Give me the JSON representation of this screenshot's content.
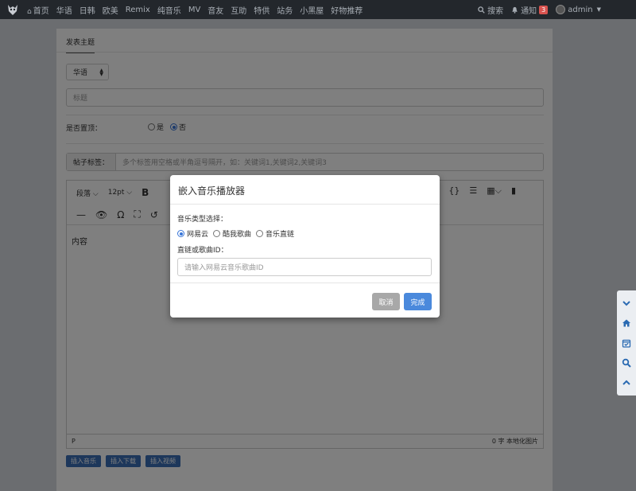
{
  "navbar": {
    "home": "首页",
    "items": [
      "华语",
      "日韩",
      "欧美",
      "Remix",
      "纯音乐",
      "MV",
      "音友",
      "互助",
      "特供",
      "站务",
      "小黑屋",
      "好物推荐"
    ],
    "search": "搜索",
    "notify": "通知",
    "notify_count": "3",
    "user": "admin"
  },
  "form": {
    "page_title": "发表主题",
    "lang_select": "华语",
    "title_placeholder": "标题",
    "pin_label": "是否置顶：",
    "pin_yes": "是",
    "pin_no": "否",
    "tag_label": "帖子标签：",
    "tag_placeholder": "多个标签用空格或半角逗号隔开，如：关键词1,关键词2,关键词3"
  },
  "editor": {
    "block_format": "段落",
    "font_size": "12pt",
    "bold": "B",
    "content_placeholder": "内容",
    "status_path": "P",
    "word_count": "0 字",
    "localize_images": "本地化图片"
  },
  "insert_buttons": [
    "插入音乐",
    "插入下载",
    "插入视频"
  ],
  "modal": {
    "title": "嵌入音乐播放器",
    "type_label": "音乐类型选择：",
    "types": [
      "网易云",
      "酷我歌曲",
      "音乐直链"
    ],
    "id_label": "直链或歌曲ID：",
    "id_placeholder": "请输入网易云音乐歌曲ID",
    "cancel": "取消",
    "done": "完成"
  },
  "side_buttons": [
    "chevron-down-icon",
    "home-icon",
    "calendar-check-icon",
    "search-icon",
    "chevron-up-icon"
  ]
}
